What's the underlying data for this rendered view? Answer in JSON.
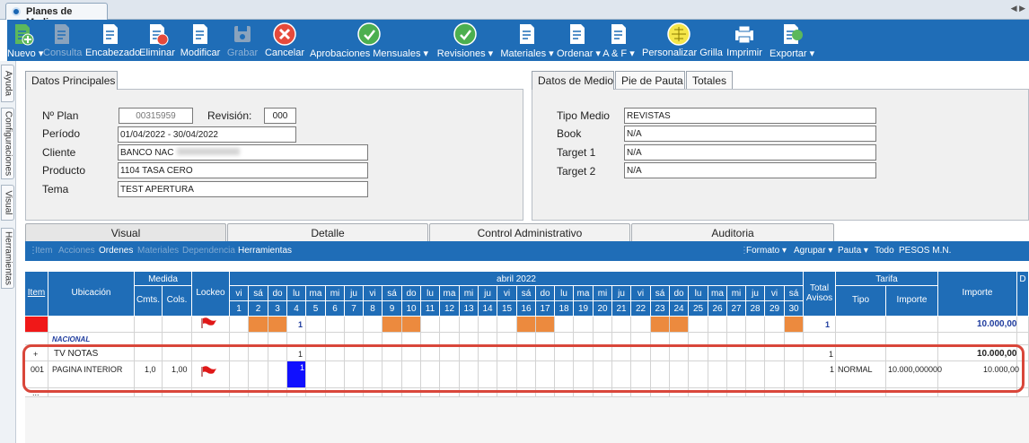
{
  "window": {
    "title": "Planes de Medios"
  },
  "toolbar": {
    "items": [
      {
        "label": "Nuevo ▾",
        "icon": "new-doc-icon"
      },
      {
        "label": "Consulta",
        "icon": "query-icon"
      },
      {
        "label": "Encabezado",
        "icon": "header-edit-icon"
      },
      {
        "label": "Eliminar",
        "icon": "delete-icon"
      },
      {
        "label": "Modificar",
        "icon": "edit-icon"
      },
      {
        "label": "Grabar",
        "icon": "save-icon"
      },
      {
        "label": "Cancelar",
        "icon": "cancel-icon"
      },
      {
        "label": "Aprobaciones Mensuales ▾",
        "icon": "approve-icon"
      },
      {
        "label": "Revisiones ▾",
        "icon": "review-icon"
      },
      {
        "label": "Materiales ▾",
        "icon": "materials-icon"
      },
      {
        "label": "Ordenar ▾",
        "icon": "order-icon"
      },
      {
        "label": "A & F ▾",
        "icon": "af-icon"
      },
      {
        "label": "Personalizar Grilla",
        "icon": "grid-icon"
      },
      {
        "label": "Imprimir",
        "icon": "printer-icon"
      },
      {
        "label": "Exportar ▾",
        "icon": "export-icon"
      }
    ]
  },
  "side_tabs": [
    "Ayuda",
    "Configuraciones",
    "Visual",
    "Herramientas"
  ],
  "principal": {
    "tab": "Datos Principales",
    "plan_label": "Nº Plan",
    "plan_value": "00315959",
    "revision_label": "Revisión:",
    "revision_value": "000",
    "periodo_label": "Período",
    "periodo_value": "01/04/2022 - 30/04/2022",
    "cliente_label": "Cliente",
    "cliente_value": "BANCO NAC",
    "producto_label": "Producto",
    "producto_value": "1104 TASA CERO",
    "tema_label": "Tema",
    "tema_value": "TEST APERTURA"
  },
  "medio": {
    "tabs": [
      "Datos de Medio",
      "Pie de Pauta",
      "Totales"
    ],
    "tipo_label": "Tipo Medio",
    "tipo_value": "REVISTAS",
    "book_label": "Book",
    "book_value": "N/A",
    "t1_label": "Target 1",
    "t1_value": "N/A",
    "t2_label": "Target 2",
    "t2_value": "N/A"
  },
  "bottom_tabs": [
    "Visual",
    "Detalle",
    "Control Administrativo",
    "Auditoria"
  ],
  "subbar": {
    "left": [
      "Item",
      "Acciones",
      "Ordenes",
      "Materiales",
      "Dependencia",
      "Herramientas"
    ],
    "right": [
      "Formato ▾",
      "Agrupar ▾",
      "Pauta ▾",
      "Todo",
      "PESOS M.N."
    ]
  },
  "grid": {
    "h_item": "Item",
    "h_ubic": "Ubicación",
    "h_medida": "Medida",
    "h_cmts": "Cmts.",
    "h_cols": "Cols.",
    "h_lockeo": "Lockeo",
    "h_month": "abril 2022",
    "h_total": "Total Avisos",
    "h_tarifa": "Tarifa",
    "h_tipo": "Tipo",
    "h_importe": "Importe",
    "h_importe2": "Importe",
    "h_d": "D",
    "days": [
      "vi",
      "sá",
      "do",
      "lu",
      "ma",
      "mi",
      "ju",
      "vi",
      "sá",
      "do",
      "lu",
      "ma",
      "mi",
      "ju",
      "vi",
      "sá",
      "do",
      "lu",
      "ma",
      "mi",
      "ju",
      "vi",
      "sá",
      "do",
      "lu",
      "ma",
      "mi",
      "ju",
      "vi",
      "sá"
    ],
    "nums": [
      "1",
      "2",
      "3",
      "4",
      "5",
      "6",
      "7",
      "8",
      "9",
      "10",
      "11",
      "12",
      "13",
      "14",
      "15",
      "16",
      "17",
      "18",
      "19",
      "20",
      "21",
      "22",
      "23",
      "24",
      "25",
      "26",
      "27",
      "28",
      "29",
      "30"
    ],
    "r1_day4": "1",
    "r1_total": "1",
    "r1_importe": "10.000,00",
    "nacional": "NACIONAL",
    "r2_item": "+",
    "r2_ubic": "TV NOTAS",
    "r2_day4": "1",
    "r2_total": "1",
    "r2_importe": "10.000,00",
    "r3_item": "001",
    "r3_ubic": "PAGINA INTERIOR",
    "r3_cmts": "1,0",
    "r3_cols": "1,00",
    "r3_day4": "1",
    "r3_total": "1",
    "r3_tipo": "NORMAL",
    "r3_tarifa": "10.000,000000",
    "r3_importe": "10.000,00",
    "footer": "..."
  },
  "colors": {
    "accent": "#1f6db7",
    "weekend": "#ec8a3e",
    "highlight": "#d9463a"
  }
}
